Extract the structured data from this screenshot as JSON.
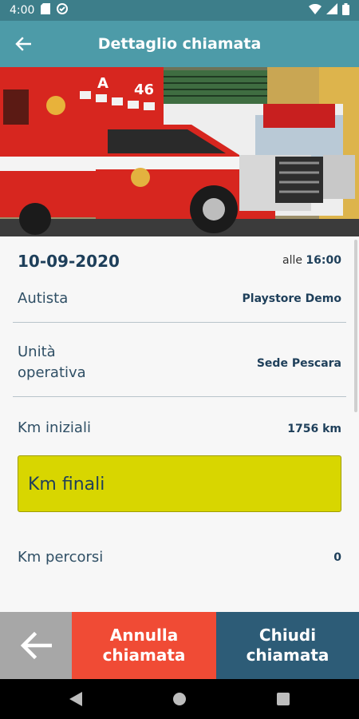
{
  "status_bar": {
    "time": "4:00",
    "icons_left": [
      "sd-card-icon",
      "sync-icon"
    ],
    "icons_right": [
      "wifi-icon",
      "signal-icon",
      "battery-icon"
    ]
  },
  "app_bar": {
    "title": "Dettaglio chiamata",
    "back_icon": "arrow-back-icon",
    "color": "#4d9ba8"
  },
  "details": {
    "date": "10-09-2020",
    "time_prefix": "alle",
    "time": "16:00",
    "driver_label": "Autista",
    "driver_value": "Playstore Demo",
    "unit_label_line1": "Unità",
    "unit_label_line2": "operativa",
    "unit_value": "Sede Pescara",
    "km_start_label": "Km iniziali",
    "km_start_value": "1756 km",
    "km_end_placeholder": "Km finali",
    "km_traveled_label": "Km percorsi",
    "km_traveled_value": "0"
  },
  "bottom_actions": {
    "back_icon": "arrow-back-icon",
    "cancel_line1": "Annulla",
    "cancel_line2": "chiamata",
    "close_line1": "Chiudi",
    "close_line2": "chiamata",
    "colors": {
      "back": "#a7a7a7",
      "cancel": "#f04b35",
      "close": "#2d5c77",
      "km_field": "#d8d600"
    }
  },
  "hero": {
    "unit_marking_1": "A",
    "unit_marking_2": "46"
  }
}
